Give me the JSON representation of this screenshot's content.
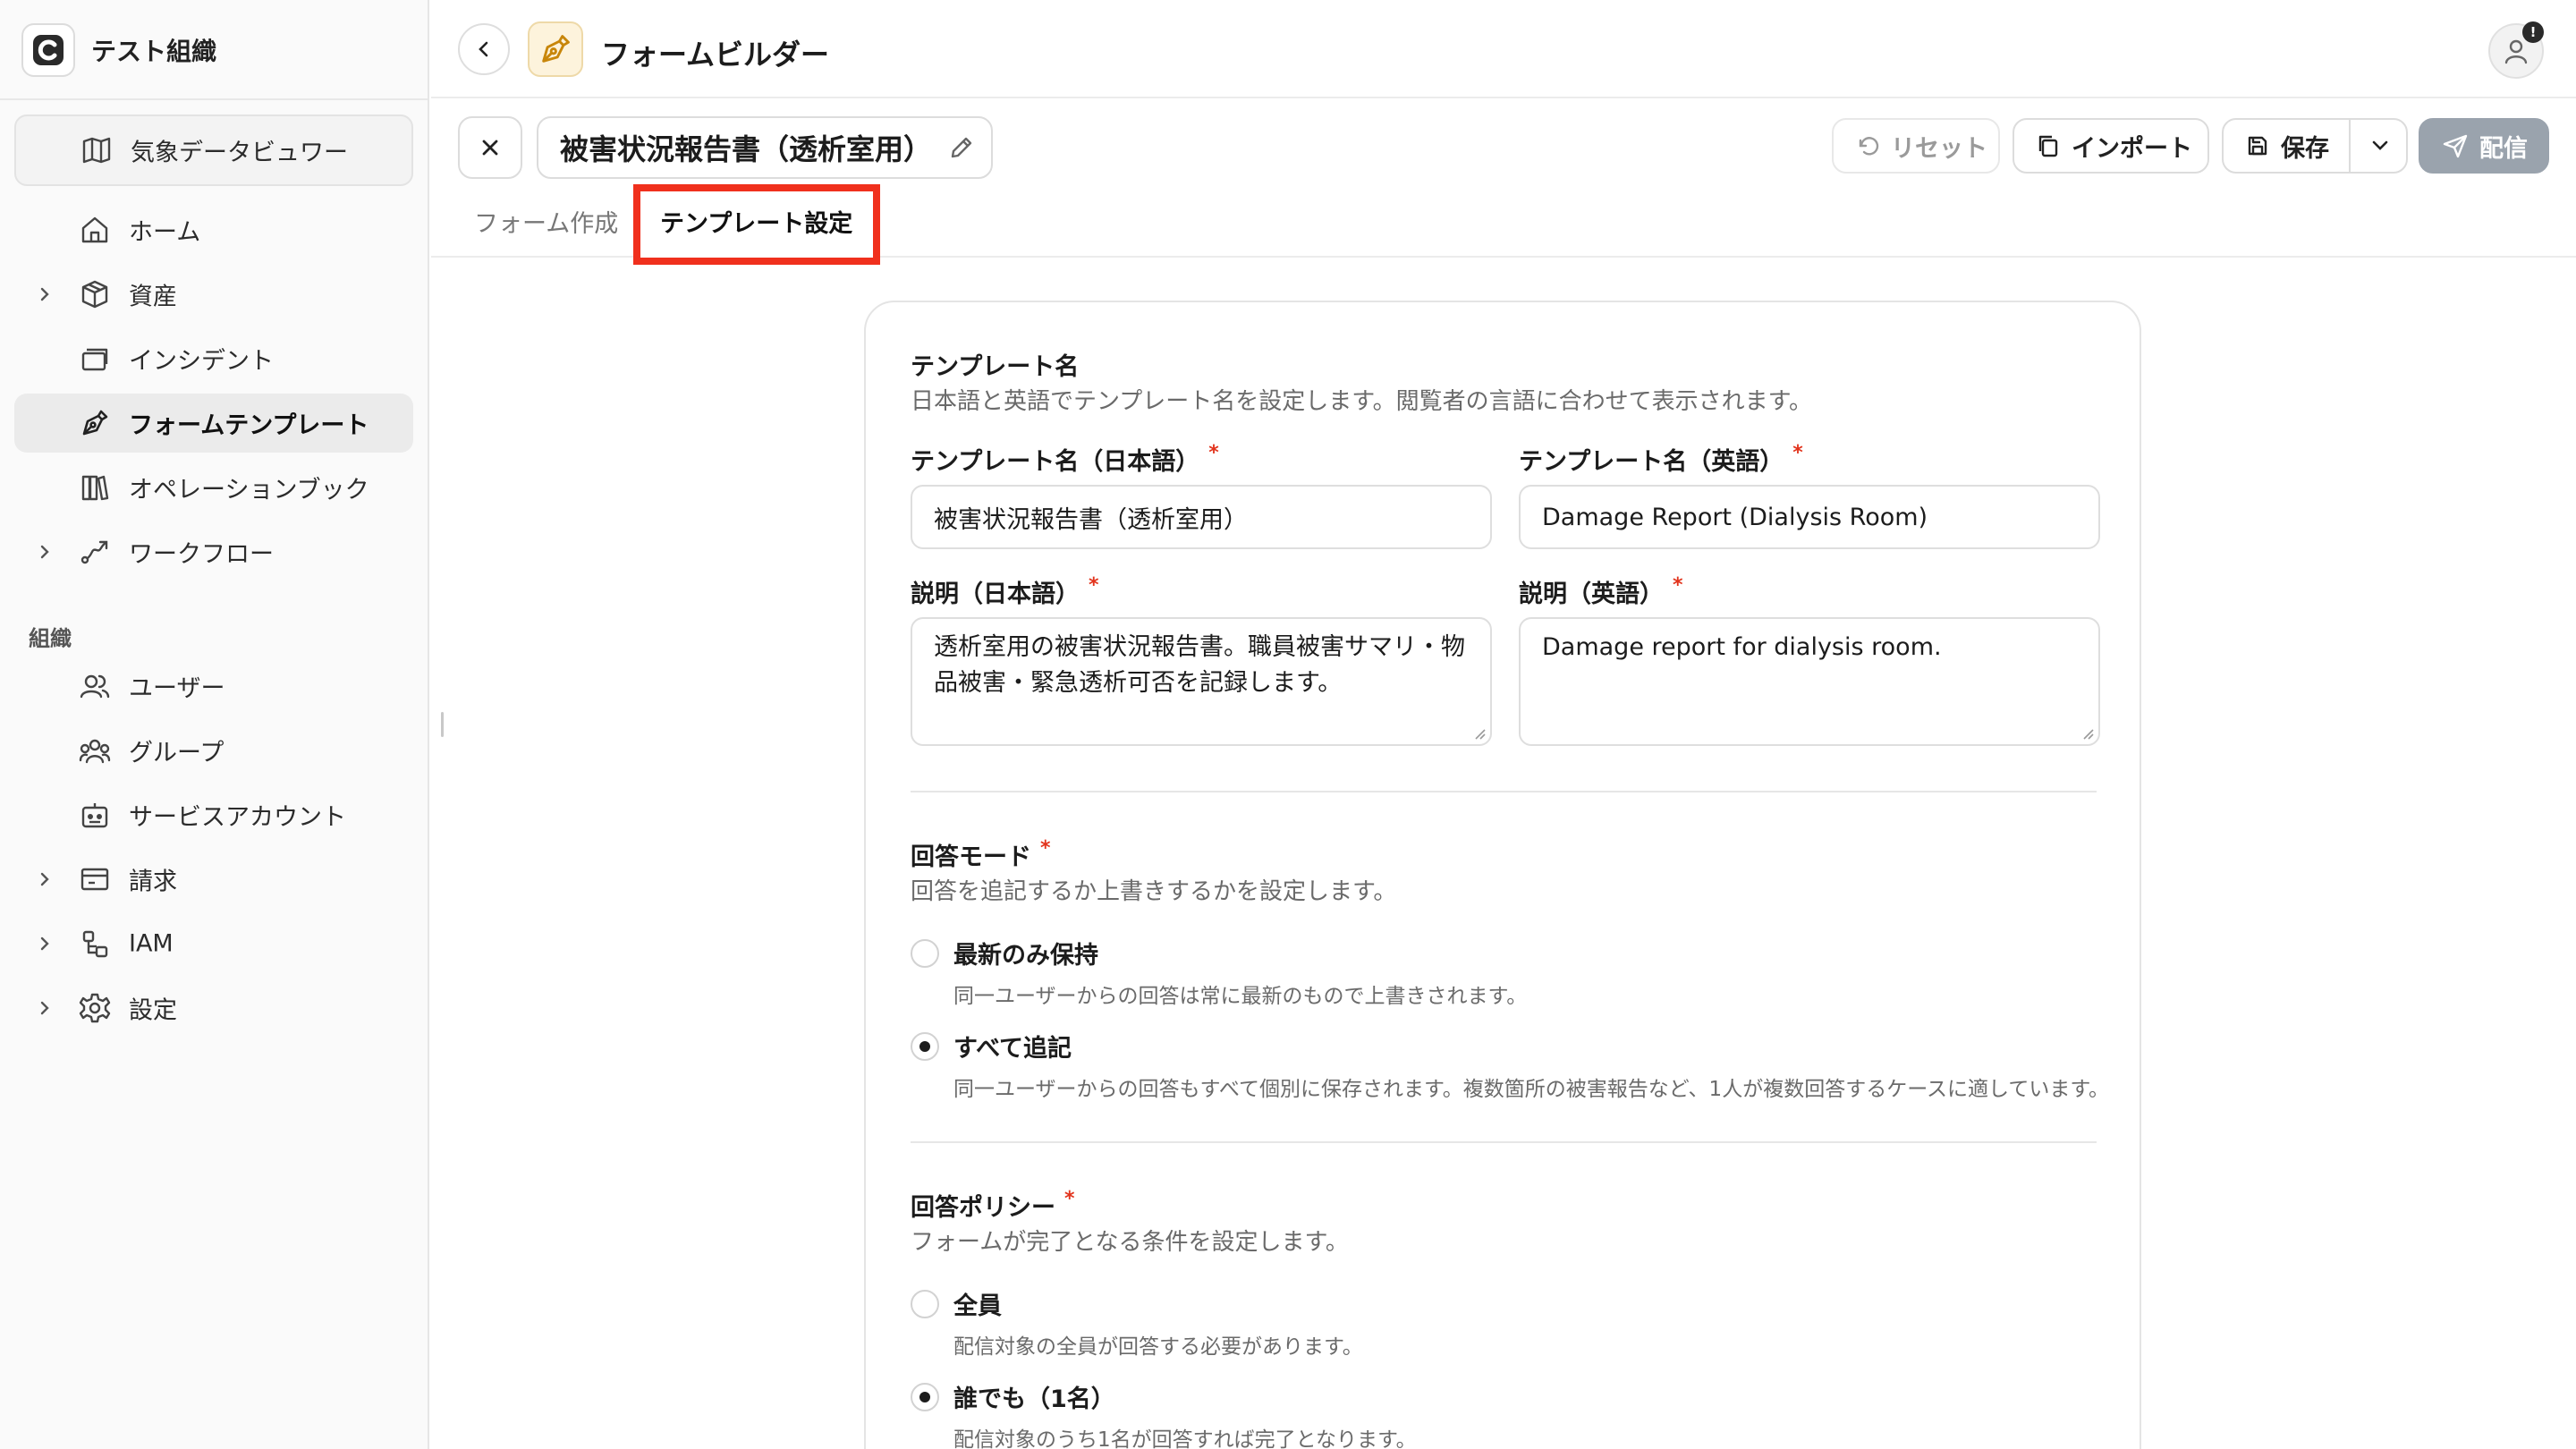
{
  "org": {
    "name": "テスト組織"
  },
  "sidebar": {
    "items": [
      {
        "label": "気象データビュワー",
        "icon": "map-icon"
      },
      {
        "label": "ホーム",
        "icon": "home-icon"
      },
      {
        "label": "資産",
        "icon": "box-icon"
      },
      {
        "label": "インシデント",
        "icon": "cards-icon"
      },
      {
        "label": "フォームテンプレート",
        "icon": "pen-nib-icon"
      },
      {
        "label": "オペレーションブック",
        "icon": "books-icon"
      },
      {
        "label": "ワークフロー",
        "icon": "workflow-icon"
      }
    ],
    "section_label": "組織",
    "org_items": [
      {
        "label": "ユーザー",
        "icon": "users-icon"
      },
      {
        "label": "グループ",
        "icon": "group-icon"
      },
      {
        "label": "サービスアカウント",
        "icon": "bot-icon"
      },
      {
        "label": "請求",
        "icon": "billing-icon"
      },
      {
        "label": "IAM",
        "icon": "iam-icon"
      },
      {
        "label": "設定",
        "icon": "gear-icon"
      }
    ]
  },
  "topbar": {
    "title": "フォームビルダー",
    "avatar_badge": "!"
  },
  "form_header": {
    "template_name": "被害状況報告書（透析室用）",
    "reset_label": "リセット",
    "import_label": "インポート",
    "save_label": "保存",
    "send_label": "配信"
  },
  "tabs": [
    {
      "label": "フォーム作成",
      "active": false
    },
    {
      "label": "テンプレート設定",
      "active": true
    }
  ],
  "template_name_section": {
    "title": "テンプレート名",
    "description": "日本語と英語でテンプレート名を設定します。閲覧者の言語に合わせて表示されます。",
    "name_ja_label": "テンプレート名（日本語）",
    "name_ja_value": "被害状況報告書（透析室用）",
    "name_en_label": "テンプレート名（英語）",
    "name_en_value": "Damage Report (Dialysis Room)",
    "desc_ja_label": "説明（日本語）",
    "desc_ja_line1": "透析室用の被害状況報告書。職員被害サマリ・物",
    "desc_ja_line2": "品被害・緊急透析可否を記録します。",
    "desc_en_label": "説明（英語）",
    "desc_en_value": "Damage report for dialysis room.",
    "required_mark": "*"
  },
  "answer_mode": {
    "title": "回答モード",
    "description": "回答を追記するか上書きするかを設定します。",
    "options": [
      {
        "label": "最新のみ保持",
        "description": "同一ユーザーからの回答は常に最新のもので上書きされます。",
        "selected": false
      },
      {
        "label": "すべて追記",
        "description": "同一ユーザーからの回答もすべて個別に保存されます。複数箇所の被害報告など、1人が複数回答するケースに適しています。",
        "selected": true
      }
    ]
  },
  "answer_policy": {
    "title": "回答ポリシー",
    "description": "フォームが完了となる条件を設定します。",
    "options": [
      {
        "label": "全員",
        "description": "配信対象の全員が回答する必要があります。",
        "selected": false
      },
      {
        "label": "誰でも（1名）",
        "description": "配信対象のうち1名が回答すれば完了となります。",
        "selected": true
      }
    ]
  },
  "colors": {
    "accent_highlight": "#f0301d",
    "required": "#e2341d",
    "send_button": "#9aa3ad"
  }
}
